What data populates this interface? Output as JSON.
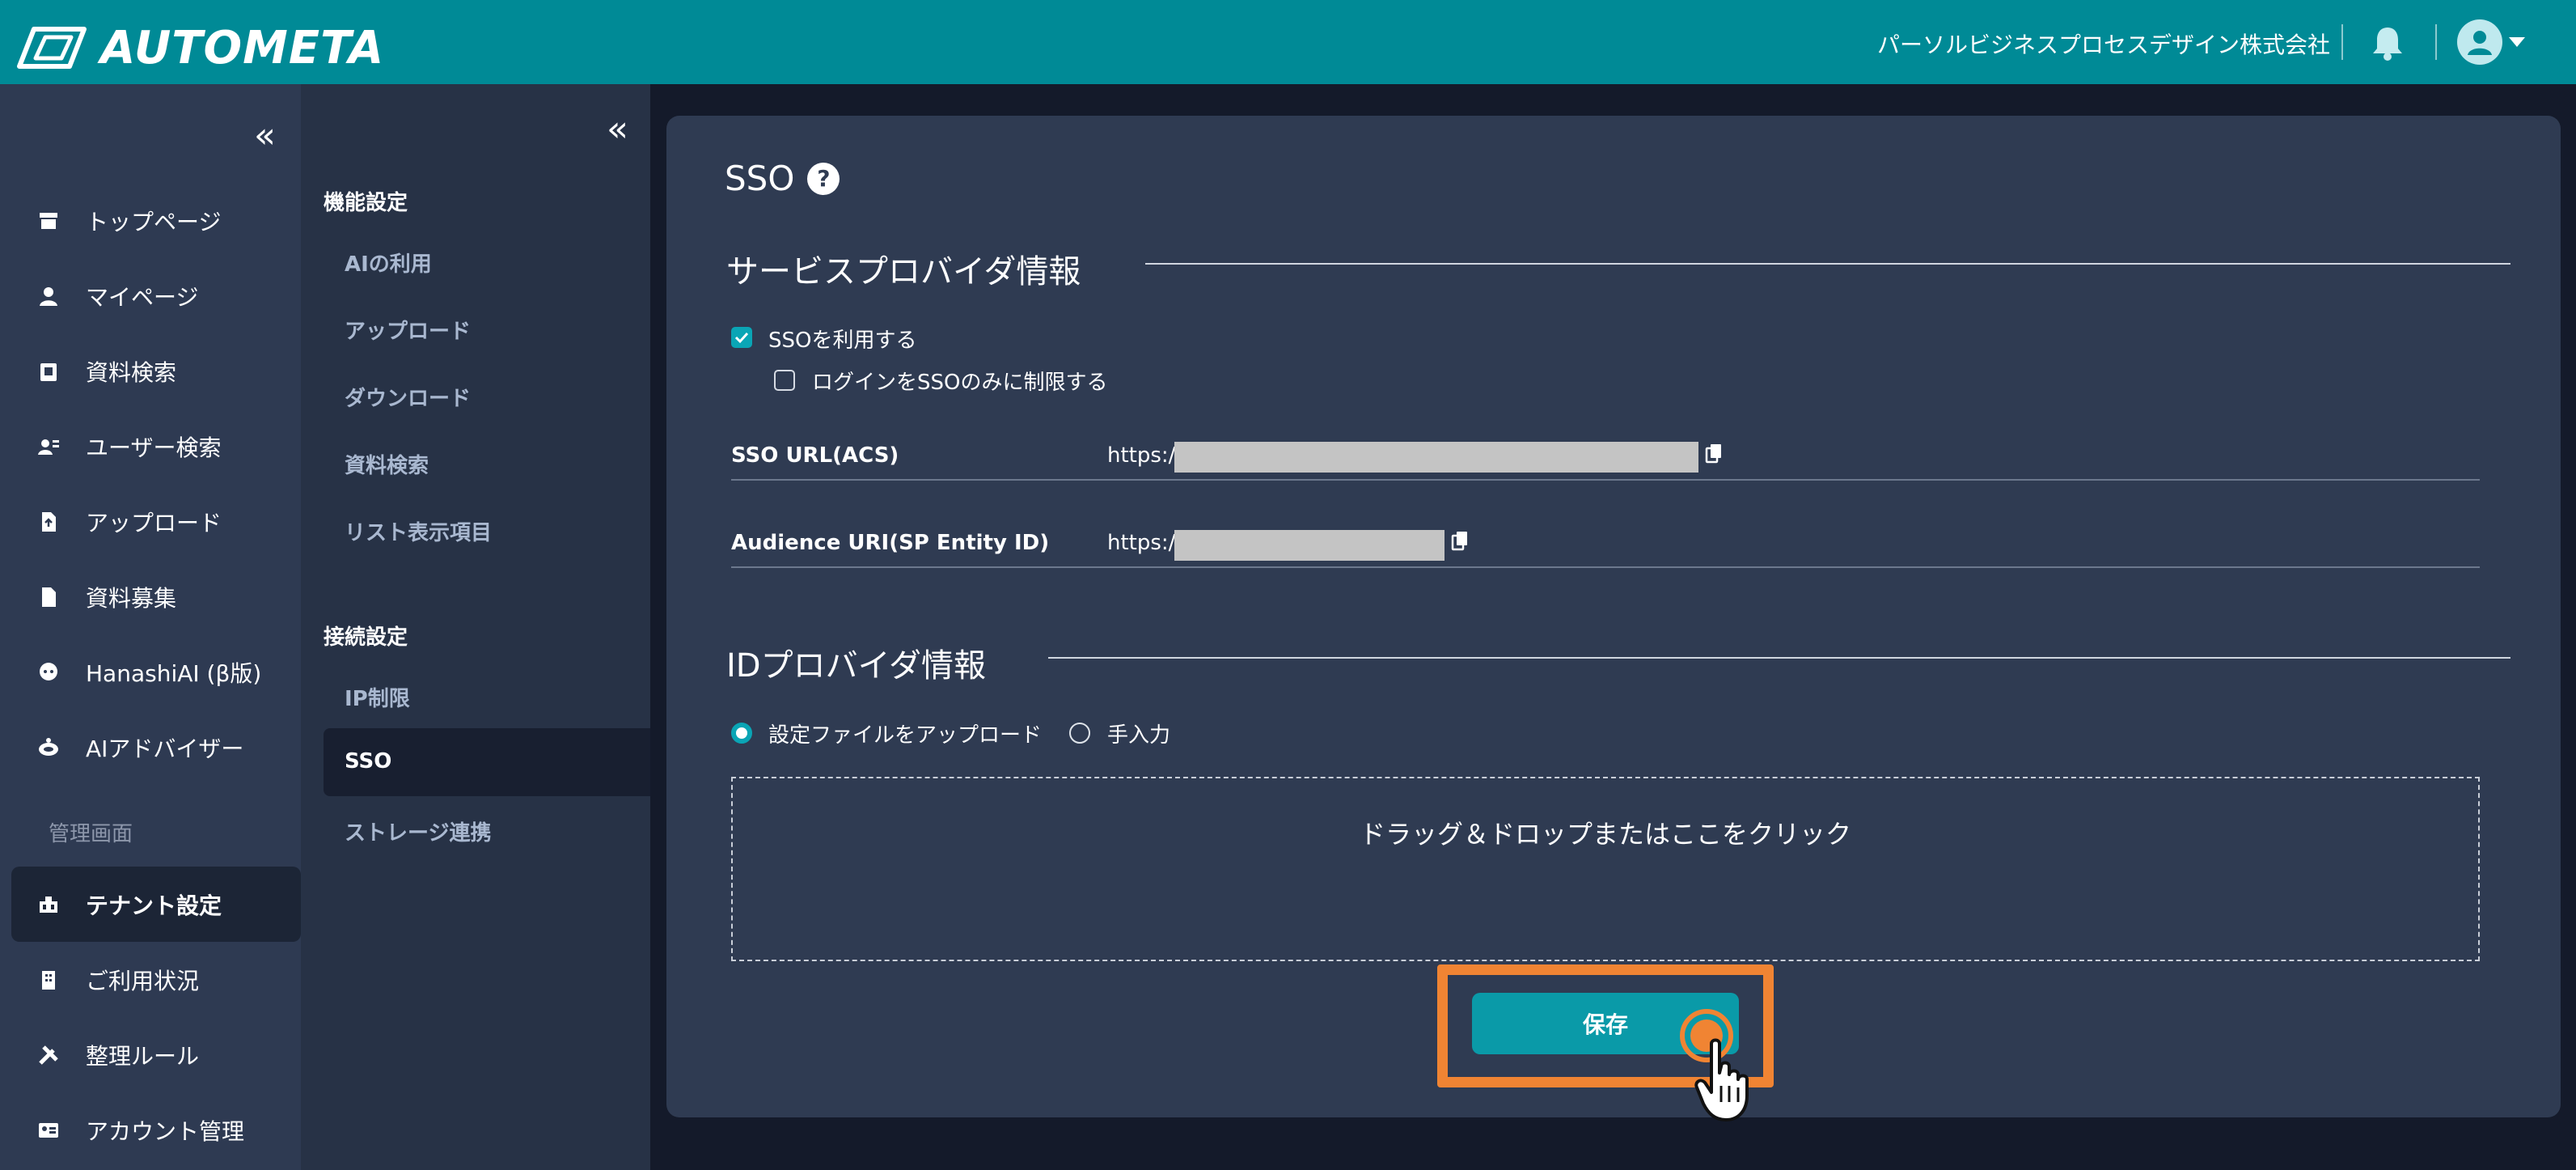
{
  "header": {
    "logo_text": "AUTOMETA",
    "company": "パーソルビジネスプロセスデザイン株式会社"
  },
  "sidebar": {
    "items": [
      {
        "label": "トップページ",
        "icon": "store-icon"
      },
      {
        "label": "マイページ",
        "icon": "person-icon"
      },
      {
        "label": "資料検索",
        "icon": "document-search-icon"
      },
      {
        "label": "ユーザー検索",
        "icon": "user-search-icon"
      },
      {
        "label": "アップロード",
        "icon": "file-upload-icon"
      },
      {
        "label": "資料募集",
        "icon": "file-icon"
      },
      {
        "label": "HanashiAI (β版)",
        "icon": "chat-icon"
      },
      {
        "label": "AIアドバイザー",
        "icon": "robot-icon"
      }
    ],
    "admin_section": "管理画面",
    "admin_items": [
      {
        "label": "テナント設定",
        "icon": "tenant-icon"
      },
      {
        "label": "ご利用状況",
        "icon": "building-icon"
      },
      {
        "label": "整理ルール",
        "icon": "tools-icon"
      },
      {
        "label": "アカウント管理",
        "icon": "id-card-icon"
      }
    ]
  },
  "subnav": {
    "section1": "機能設定",
    "section1_items": [
      "AIの利用",
      "アップロード",
      "ダウンロード",
      "資料検索",
      "リスト表示項目"
    ],
    "section2": "接続設定",
    "section2_items": [
      "IP制限",
      "SSO",
      "ストレージ連携"
    ]
  },
  "main": {
    "title": "SSO",
    "help_glyph": "?",
    "sp_heading": "サービスプロバイダ情報",
    "use_sso_label": "SSOを利用する",
    "use_sso_checked": true,
    "restrict_label": "ログインをSSOのみに制限する",
    "restrict_checked": false,
    "sso_url_label": "SSO URL(ACS)",
    "sso_url_value": "https://",
    "audience_label": "Audience URI(SP Entity ID)",
    "audience_value": "https://",
    "idp_heading": "IDプロバイダ情報",
    "radio_upload": "設定ファイルをアップロード",
    "radio_manual": "手入力",
    "dropzone_text": "ドラッグ＆ドロップまたはここをクリック",
    "save_label": "保存"
  },
  "colors": {
    "header": "#008a96",
    "accent": "#0aa5b5",
    "highlight": "#f08433"
  }
}
